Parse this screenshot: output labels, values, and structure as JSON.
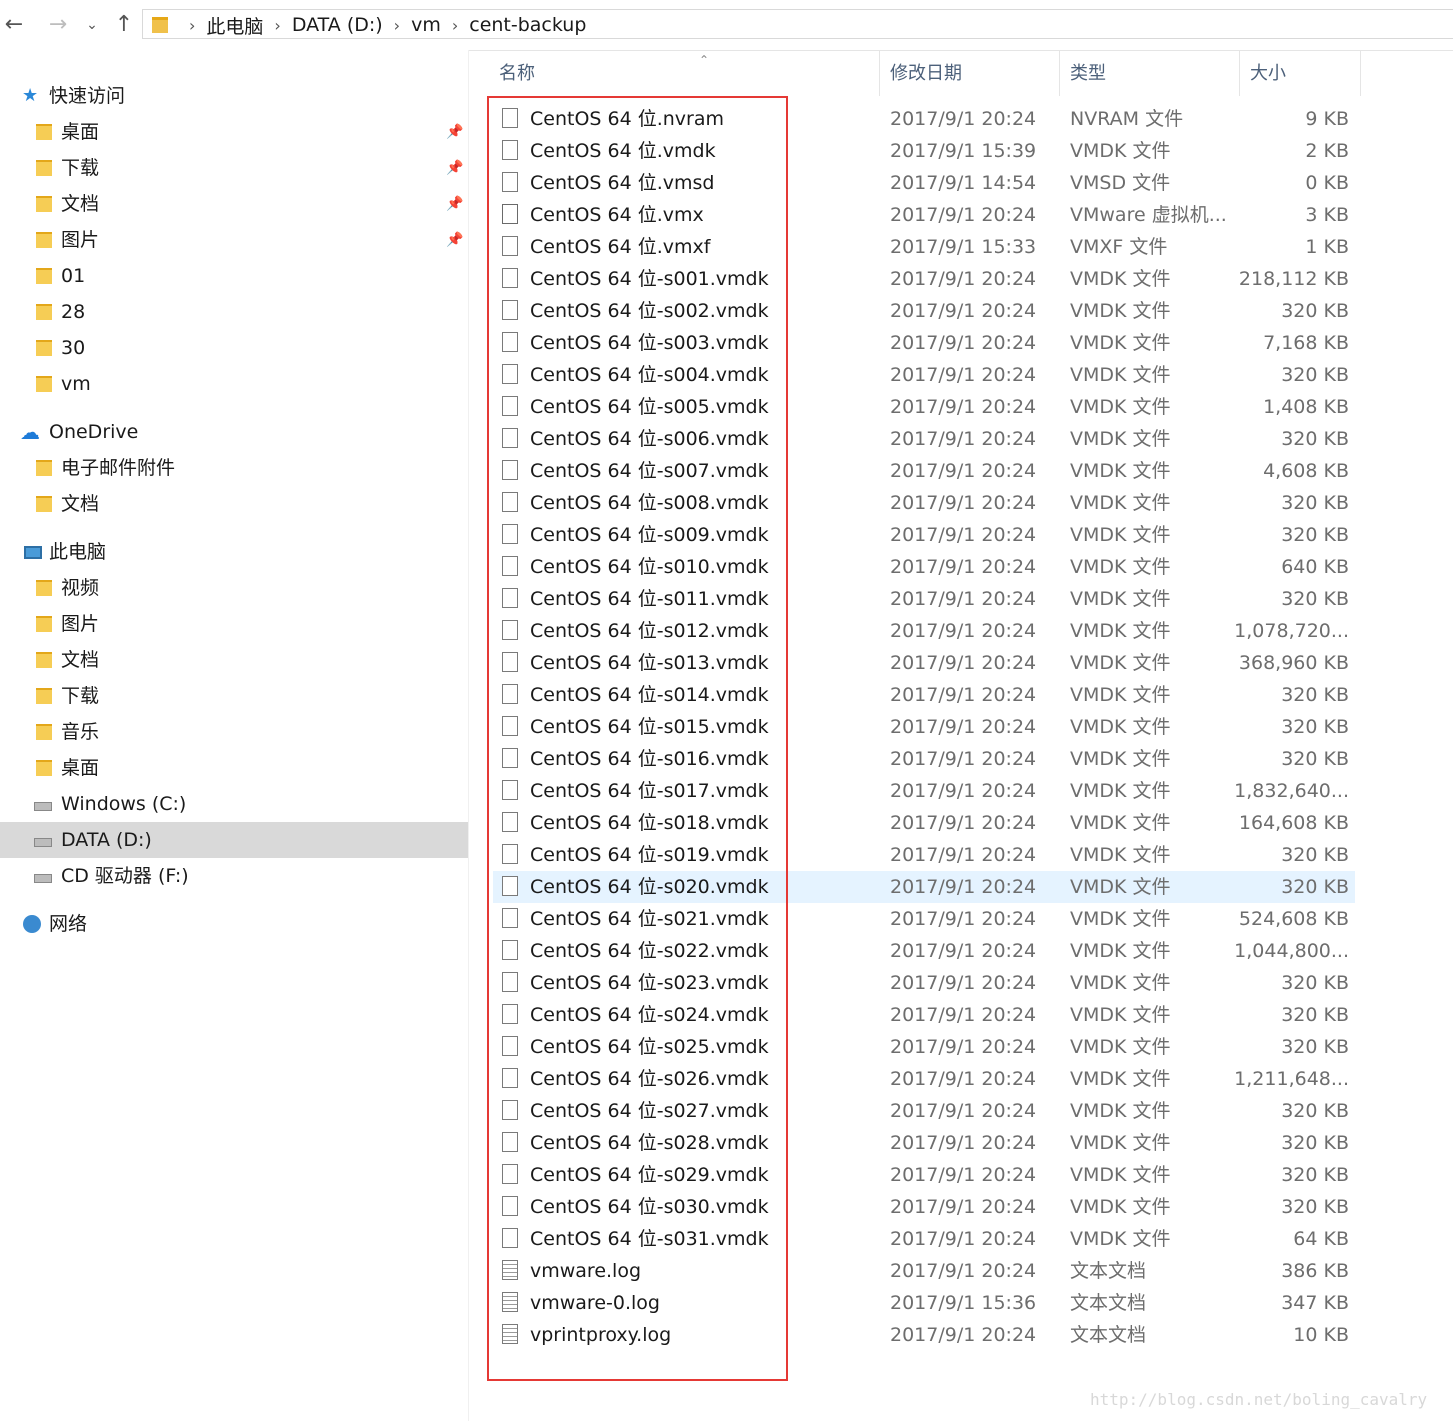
{
  "nav": {
    "back_icon": "back-arrow-icon",
    "forward_icon": "forward-arrow-icon",
    "recent_icon": "chevron-down-icon",
    "up_icon": "up-arrow-icon",
    "breadcrumb": [
      "此电脑",
      "DATA (D:)",
      "vm",
      "cent-backup"
    ]
  },
  "sidebar": {
    "quick_access": "快速访问",
    "quick_items": [
      "桌面",
      "下载",
      "文档",
      "图片",
      "01",
      "28",
      "30",
      "vm"
    ],
    "onedrive": "OneDrive",
    "onedrive_items": [
      "电子邮件附件",
      "文档"
    ],
    "this_pc": "此电脑",
    "pc_items": [
      "视频",
      "图片",
      "文档",
      "下载",
      "音乐",
      "桌面",
      "Windows (C:)",
      "DATA (D:)",
      "CD 驱动器 (F:)"
    ],
    "network": "网络",
    "selected": "DATA (D:)"
  },
  "columns": {
    "name": "名称",
    "date": "修改日期",
    "type": "类型",
    "size": "大小"
  },
  "files": [
    {
      "name": "CentOS 64 位.nvram",
      "date": "2017/9/1 20:24",
      "type": "NVRAM 文件",
      "size": "9 KB",
      "icon": "file"
    },
    {
      "name": "CentOS 64 位.vmdk",
      "date": "2017/9/1 15:39",
      "type": "VMDK 文件",
      "size": "2 KB",
      "icon": "file"
    },
    {
      "name": "CentOS 64 位.vmsd",
      "date": "2017/9/1 14:54",
      "type": "VMSD 文件",
      "size": "0 KB",
      "icon": "file"
    },
    {
      "name": "CentOS 64 位.vmx",
      "date": "2017/9/1 20:24",
      "type": "VMware 虚拟机...",
      "size": "3 KB",
      "icon": "vmx"
    },
    {
      "name": "CentOS 64 位.vmxf",
      "date": "2017/9/1 15:33",
      "type": "VMXF 文件",
      "size": "1 KB",
      "icon": "file"
    },
    {
      "name": "CentOS 64 位-s001.vmdk",
      "date": "2017/9/1 20:24",
      "type": "VMDK 文件",
      "size": "218,112 KB",
      "icon": "file"
    },
    {
      "name": "CentOS 64 位-s002.vmdk",
      "date": "2017/9/1 20:24",
      "type": "VMDK 文件",
      "size": "320 KB",
      "icon": "file"
    },
    {
      "name": "CentOS 64 位-s003.vmdk",
      "date": "2017/9/1 20:24",
      "type": "VMDK 文件",
      "size": "7,168 KB",
      "icon": "file"
    },
    {
      "name": "CentOS 64 位-s004.vmdk",
      "date": "2017/9/1 20:24",
      "type": "VMDK 文件",
      "size": "320 KB",
      "icon": "file"
    },
    {
      "name": "CentOS 64 位-s005.vmdk",
      "date": "2017/9/1 20:24",
      "type": "VMDK 文件",
      "size": "1,408 KB",
      "icon": "file"
    },
    {
      "name": "CentOS 64 位-s006.vmdk",
      "date": "2017/9/1 20:24",
      "type": "VMDK 文件",
      "size": "320 KB",
      "icon": "file"
    },
    {
      "name": "CentOS 64 位-s007.vmdk",
      "date": "2017/9/1 20:24",
      "type": "VMDK 文件",
      "size": "4,608 KB",
      "icon": "file"
    },
    {
      "name": "CentOS 64 位-s008.vmdk",
      "date": "2017/9/1 20:24",
      "type": "VMDK 文件",
      "size": "320 KB",
      "icon": "file"
    },
    {
      "name": "CentOS 64 位-s009.vmdk",
      "date": "2017/9/1 20:24",
      "type": "VMDK 文件",
      "size": "320 KB",
      "icon": "file"
    },
    {
      "name": "CentOS 64 位-s010.vmdk",
      "date": "2017/9/1 20:24",
      "type": "VMDK 文件",
      "size": "640 KB",
      "icon": "file"
    },
    {
      "name": "CentOS 64 位-s011.vmdk",
      "date": "2017/9/1 20:24",
      "type": "VMDK 文件",
      "size": "320 KB",
      "icon": "file"
    },
    {
      "name": "CentOS 64 位-s012.vmdk",
      "date": "2017/9/1 20:24",
      "type": "VMDK 文件",
      "size": "1,078,720...",
      "icon": "file"
    },
    {
      "name": "CentOS 64 位-s013.vmdk",
      "date": "2017/9/1 20:24",
      "type": "VMDK 文件",
      "size": "368,960 KB",
      "icon": "file"
    },
    {
      "name": "CentOS 64 位-s014.vmdk",
      "date": "2017/9/1 20:24",
      "type": "VMDK 文件",
      "size": "320 KB",
      "icon": "file"
    },
    {
      "name": "CentOS 64 位-s015.vmdk",
      "date": "2017/9/1 20:24",
      "type": "VMDK 文件",
      "size": "320 KB",
      "icon": "file"
    },
    {
      "name": "CentOS 64 位-s016.vmdk",
      "date": "2017/9/1 20:24",
      "type": "VMDK 文件",
      "size": "320 KB",
      "icon": "file"
    },
    {
      "name": "CentOS 64 位-s017.vmdk",
      "date": "2017/9/1 20:24",
      "type": "VMDK 文件",
      "size": "1,832,640...",
      "icon": "file"
    },
    {
      "name": "CentOS 64 位-s018.vmdk",
      "date": "2017/9/1 20:24",
      "type": "VMDK 文件",
      "size": "164,608 KB",
      "icon": "file"
    },
    {
      "name": "CentOS 64 位-s019.vmdk",
      "date": "2017/9/1 20:24",
      "type": "VMDK 文件",
      "size": "320 KB",
      "icon": "file"
    },
    {
      "name": "CentOS 64 位-s020.vmdk",
      "date": "2017/9/1 20:24",
      "type": "VMDK 文件",
      "size": "320 KB",
      "icon": "file",
      "hover": true
    },
    {
      "name": "CentOS 64 位-s021.vmdk",
      "date": "2017/9/1 20:24",
      "type": "VMDK 文件",
      "size": "524,608 KB",
      "icon": "file"
    },
    {
      "name": "CentOS 64 位-s022.vmdk",
      "date": "2017/9/1 20:24",
      "type": "VMDK 文件",
      "size": "1,044,800...",
      "icon": "file"
    },
    {
      "name": "CentOS 64 位-s023.vmdk",
      "date": "2017/9/1 20:24",
      "type": "VMDK 文件",
      "size": "320 KB",
      "icon": "file"
    },
    {
      "name": "CentOS 64 位-s024.vmdk",
      "date": "2017/9/1 20:24",
      "type": "VMDK 文件",
      "size": "320 KB",
      "icon": "file"
    },
    {
      "name": "CentOS 64 位-s025.vmdk",
      "date": "2017/9/1 20:24",
      "type": "VMDK 文件",
      "size": "320 KB",
      "icon": "file"
    },
    {
      "name": "CentOS 64 位-s026.vmdk",
      "date": "2017/9/1 20:24",
      "type": "VMDK 文件",
      "size": "1,211,648...",
      "icon": "file"
    },
    {
      "name": "CentOS 64 位-s027.vmdk",
      "date": "2017/9/1 20:24",
      "type": "VMDK 文件",
      "size": "320 KB",
      "icon": "file"
    },
    {
      "name": "CentOS 64 位-s028.vmdk",
      "date": "2017/9/1 20:24",
      "type": "VMDK 文件",
      "size": "320 KB",
      "icon": "file"
    },
    {
      "name": "CentOS 64 位-s029.vmdk",
      "date": "2017/9/1 20:24",
      "type": "VMDK 文件",
      "size": "320 KB",
      "icon": "file"
    },
    {
      "name": "CentOS 64 位-s030.vmdk",
      "date": "2017/9/1 20:24",
      "type": "VMDK 文件",
      "size": "320 KB",
      "icon": "file"
    },
    {
      "name": "CentOS 64 位-s031.vmdk",
      "date": "2017/9/1 20:24",
      "type": "VMDK 文件",
      "size": "64 KB",
      "icon": "file"
    },
    {
      "name": "vmware.log",
      "date": "2017/9/1 20:24",
      "type": "文本文档",
      "size": "386 KB",
      "icon": "log"
    },
    {
      "name": "vmware-0.log",
      "date": "2017/9/1 15:36",
      "type": "文本文档",
      "size": "347 KB",
      "icon": "log"
    },
    {
      "name": "vprintproxy.log",
      "date": "2017/9/1 20:24",
      "type": "文本文档",
      "size": "10 KB",
      "icon": "log"
    }
  ],
  "watermark": "http://blog.csdn.net/boling_cavalry",
  "colors": {
    "highlight_box": "#e53935",
    "hover_row": "#e5f3ff",
    "selected_nav": "#d9d9d9"
  }
}
